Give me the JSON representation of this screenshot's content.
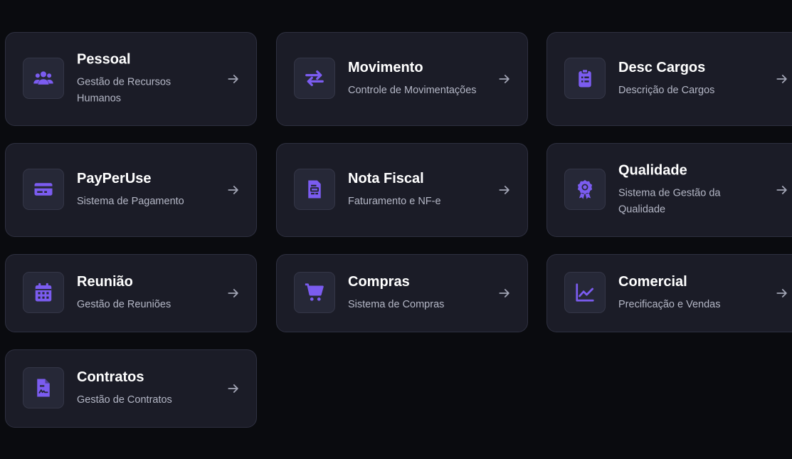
{
  "colors": {
    "accent": "#7b5cf0",
    "background": "#0a0b0f",
    "card": "#1b1c27",
    "arrow": "#a2a5b5"
  },
  "cards": [
    {
      "title": "Pessoal",
      "subtitle": "Gestão de Recursos Humanos",
      "icon": "people-icon"
    },
    {
      "title": "Movimento",
      "subtitle": "Controle de Movimentações",
      "icon": "swap-arrows-icon"
    },
    {
      "title": "Desc Cargos",
      "subtitle": "Descrição de Cargos",
      "icon": "clipboard-list-icon"
    },
    {
      "title": "PayPerUse",
      "subtitle": "Sistema de Pagamento",
      "icon": "credit-card-icon"
    },
    {
      "title": "Nota Fiscal",
      "subtitle": "Faturamento e NF-e",
      "icon": "document-icon"
    },
    {
      "title": "Qualidade",
      "subtitle": "Sistema de Gestão da Qualidade",
      "icon": "award-badge-icon"
    },
    {
      "title": "Reunião",
      "subtitle": "Gestão de Reuniões",
      "icon": "calendar-icon"
    },
    {
      "title": "Compras",
      "subtitle": "Sistema de Compras",
      "icon": "shopping-cart-icon"
    },
    {
      "title": "Comercial",
      "subtitle": "Precificação e Vendas",
      "icon": "line-chart-icon"
    },
    {
      "title": "Contratos",
      "subtitle": "Gestão de Contratos",
      "icon": "contract-document-icon"
    }
  ]
}
